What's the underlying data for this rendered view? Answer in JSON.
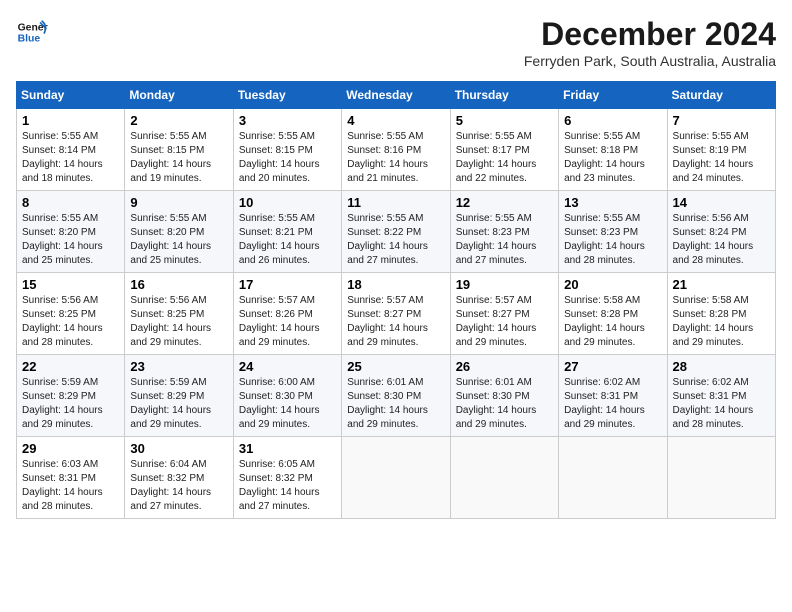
{
  "header": {
    "logo_line1": "General",
    "logo_line2": "Blue",
    "month_title": "December 2024",
    "location": "Ferryden Park, South Australia, Australia"
  },
  "days_of_week": [
    "Sunday",
    "Monday",
    "Tuesday",
    "Wednesday",
    "Thursday",
    "Friday",
    "Saturday"
  ],
  "weeks": [
    [
      {
        "day": "1",
        "sunrise": "5:55 AM",
        "sunset": "8:14 PM",
        "daylight": "14 hours and 18 minutes."
      },
      {
        "day": "2",
        "sunrise": "5:55 AM",
        "sunset": "8:15 PM",
        "daylight": "14 hours and 19 minutes."
      },
      {
        "day": "3",
        "sunrise": "5:55 AM",
        "sunset": "8:15 PM",
        "daylight": "14 hours and 20 minutes."
      },
      {
        "day": "4",
        "sunrise": "5:55 AM",
        "sunset": "8:16 PM",
        "daylight": "14 hours and 21 minutes."
      },
      {
        "day": "5",
        "sunrise": "5:55 AM",
        "sunset": "8:17 PM",
        "daylight": "14 hours and 22 minutes."
      },
      {
        "day": "6",
        "sunrise": "5:55 AM",
        "sunset": "8:18 PM",
        "daylight": "14 hours and 23 minutes."
      },
      {
        "day": "7",
        "sunrise": "5:55 AM",
        "sunset": "8:19 PM",
        "daylight": "14 hours and 24 minutes."
      }
    ],
    [
      {
        "day": "8",
        "sunrise": "5:55 AM",
        "sunset": "8:20 PM",
        "daylight": "14 hours and 25 minutes."
      },
      {
        "day": "9",
        "sunrise": "5:55 AM",
        "sunset": "8:20 PM",
        "daylight": "14 hours and 25 minutes."
      },
      {
        "day": "10",
        "sunrise": "5:55 AM",
        "sunset": "8:21 PM",
        "daylight": "14 hours and 26 minutes."
      },
      {
        "day": "11",
        "sunrise": "5:55 AM",
        "sunset": "8:22 PM",
        "daylight": "14 hours and 27 minutes."
      },
      {
        "day": "12",
        "sunrise": "5:55 AM",
        "sunset": "8:23 PM",
        "daylight": "14 hours and 27 minutes."
      },
      {
        "day": "13",
        "sunrise": "5:55 AM",
        "sunset": "8:23 PM",
        "daylight": "14 hours and 28 minutes."
      },
      {
        "day": "14",
        "sunrise": "5:56 AM",
        "sunset": "8:24 PM",
        "daylight": "14 hours and 28 minutes."
      }
    ],
    [
      {
        "day": "15",
        "sunrise": "5:56 AM",
        "sunset": "8:25 PM",
        "daylight": "14 hours and 28 minutes."
      },
      {
        "day": "16",
        "sunrise": "5:56 AM",
        "sunset": "8:25 PM",
        "daylight": "14 hours and 29 minutes."
      },
      {
        "day": "17",
        "sunrise": "5:57 AM",
        "sunset": "8:26 PM",
        "daylight": "14 hours and 29 minutes."
      },
      {
        "day": "18",
        "sunrise": "5:57 AM",
        "sunset": "8:27 PM",
        "daylight": "14 hours and 29 minutes."
      },
      {
        "day": "19",
        "sunrise": "5:57 AM",
        "sunset": "8:27 PM",
        "daylight": "14 hours and 29 minutes."
      },
      {
        "day": "20",
        "sunrise": "5:58 AM",
        "sunset": "8:28 PM",
        "daylight": "14 hours and 29 minutes."
      },
      {
        "day": "21",
        "sunrise": "5:58 AM",
        "sunset": "8:28 PM",
        "daylight": "14 hours and 29 minutes."
      }
    ],
    [
      {
        "day": "22",
        "sunrise": "5:59 AM",
        "sunset": "8:29 PM",
        "daylight": "14 hours and 29 minutes."
      },
      {
        "day": "23",
        "sunrise": "5:59 AM",
        "sunset": "8:29 PM",
        "daylight": "14 hours and 29 minutes."
      },
      {
        "day": "24",
        "sunrise": "6:00 AM",
        "sunset": "8:30 PM",
        "daylight": "14 hours and 29 minutes."
      },
      {
        "day": "25",
        "sunrise": "6:01 AM",
        "sunset": "8:30 PM",
        "daylight": "14 hours and 29 minutes."
      },
      {
        "day": "26",
        "sunrise": "6:01 AM",
        "sunset": "8:30 PM",
        "daylight": "14 hours and 29 minutes."
      },
      {
        "day": "27",
        "sunrise": "6:02 AM",
        "sunset": "8:31 PM",
        "daylight": "14 hours and 29 minutes."
      },
      {
        "day": "28",
        "sunrise": "6:02 AM",
        "sunset": "8:31 PM",
        "daylight": "14 hours and 28 minutes."
      }
    ],
    [
      {
        "day": "29",
        "sunrise": "6:03 AM",
        "sunset": "8:31 PM",
        "daylight": "14 hours and 28 minutes."
      },
      {
        "day": "30",
        "sunrise": "6:04 AM",
        "sunset": "8:32 PM",
        "daylight": "14 hours and 27 minutes."
      },
      {
        "day": "31",
        "sunrise": "6:05 AM",
        "sunset": "8:32 PM",
        "daylight": "14 hours and 27 minutes."
      },
      null,
      null,
      null,
      null
    ]
  ],
  "labels": {
    "sunrise": "Sunrise:",
    "sunset": "Sunset:",
    "daylight": "Daylight:"
  }
}
